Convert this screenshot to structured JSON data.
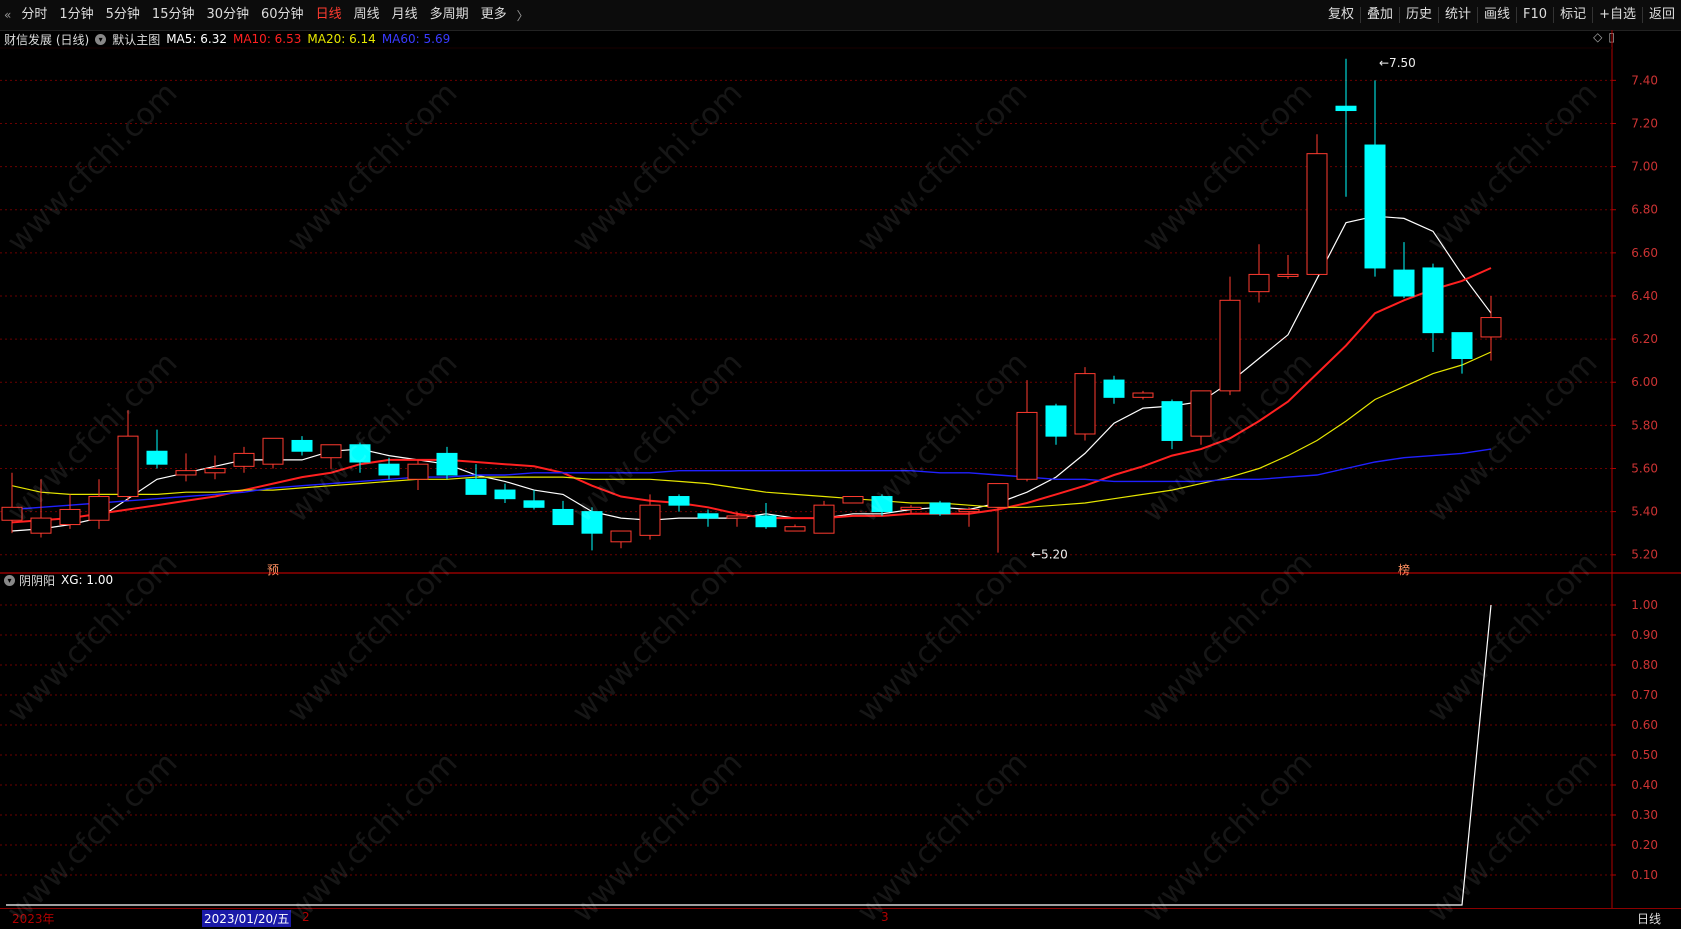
{
  "toolbar": {
    "left_items": [
      "分时",
      "1分钟",
      "5分钟",
      "15分钟",
      "30分钟",
      "60分钟",
      "日线",
      "周线",
      "月线",
      "多周期",
      "更多"
    ],
    "active": "日线",
    "right_items": [
      "复权",
      "叠加",
      "历史",
      "统计",
      "画线",
      "F10",
      "标记",
      "+自选",
      "返回"
    ]
  },
  "main_info": {
    "stock": "财信发展 (日线)",
    "chart_name": "默认主图",
    "ma5": "MA5: 6.32",
    "ma10": "MA10: 6.53",
    "ma20": "MA20: 6.14",
    "ma60": "MA60: 5.69"
  },
  "indicator_info": {
    "name": "阴阴阳",
    "value": "XG: 1.00"
  },
  "bottom": {
    "year": "2023年",
    "cursor_date": "2023/01/20/五",
    "month2": "2",
    "month3": "3",
    "period": "日线"
  },
  "watermark": "www.cfchi.com",
  "colors": {
    "up": "#ff3b30",
    "down": "#00ffff",
    "ma5": "#ffffff",
    "ma10": "#ff2020",
    "ma20": "#e6e600",
    "ma60": "#2020ff",
    "grid": "#6b0000",
    "axis": "#b00000"
  },
  "chart_data": [
    {
      "type": "candlestick",
      "title": "财信发展 (日线)",
      "ylim": [
        5.12,
        7.55
      ],
      "y_ticks": [
        5.2,
        5.4,
        5.6,
        5.8,
        6.0,
        6.2,
        6.4,
        6.6,
        6.8,
        7.0,
        7.2,
        7.4
      ],
      "annotations": [
        {
          "text": "7.50",
          "x": 47,
          "y": 7.5
        },
        {
          "text": "5.20",
          "x": 35,
          "y": 5.2
        },
        {
          "text": "预",
          "x": 9
        },
        {
          "text": "榜",
          "x": 48
        }
      ],
      "ohlc": [
        [
          5.36,
          5.58,
          5.3,
          5.42
        ],
        [
          5.3,
          5.55,
          5.28,
          5.37
        ],
        [
          5.34,
          5.48,
          5.32,
          5.41
        ],
        [
          5.36,
          5.55,
          5.32,
          5.47
        ],
        [
          5.47,
          5.87,
          5.45,
          5.75
        ],
        [
          5.68,
          5.78,
          5.6,
          5.62
        ],
        [
          5.57,
          5.67,
          5.54,
          5.59
        ],
        [
          5.58,
          5.66,
          5.55,
          5.6
        ],
        [
          5.61,
          5.7,
          5.58,
          5.67
        ],
        [
          5.62,
          5.74,
          5.6,
          5.74
        ],
        [
          5.73,
          5.75,
          5.66,
          5.68
        ],
        [
          5.65,
          5.71,
          5.6,
          5.71
        ],
        [
          5.71,
          5.72,
          5.58,
          5.63
        ],
        [
          5.62,
          5.65,
          5.55,
          5.57
        ],
        [
          5.55,
          5.64,
          5.5,
          5.62
        ],
        [
          5.67,
          5.7,
          5.55,
          5.57
        ],
        [
          5.55,
          5.62,
          5.48,
          5.48
        ],
        [
          5.5,
          5.53,
          5.44,
          5.46
        ],
        [
          5.45,
          5.5,
          5.41,
          5.42
        ],
        [
          5.41,
          5.45,
          5.34,
          5.34
        ],
        [
          5.4,
          5.42,
          5.22,
          5.3
        ],
        [
          5.26,
          5.31,
          5.23,
          5.31
        ],
        [
          5.29,
          5.48,
          5.27,
          5.43
        ],
        [
          5.47,
          5.48,
          5.4,
          5.43
        ],
        [
          5.39,
          5.41,
          5.33,
          5.37
        ],
        [
          5.37,
          5.4,
          5.33,
          5.38
        ],
        [
          5.38,
          5.44,
          5.32,
          5.33
        ],
        [
          5.31,
          5.34,
          5.31,
          5.33
        ],
        [
          5.3,
          5.45,
          5.3,
          5.43
        ],
        [
          5.44,
          5.47,
          5.44,
          5.47
        ],
        [
          5.47,
          5.48,
          5.38,
          5.4
        ],
        [
          5.41,
          5.43,
          5.39,
          5.42
        ],
        [
          5.44,
          5.45,
          5.38,
          5.39
        ],
        [
          5.4,
          5.42,
          5.33,
          5.41
        ],
        [
          5.42,
          5.53,
          5.21,
          5.53
        ],
        [
          5.55,
          6.01,
          5.54,
          5.86
        ],
        [
          5.89,
          5.9,
          5.71,
          5.75
        ],
        [
          5.76,
          6.07,
          5.73,
          6.04
        ],
        [
          6.01,
          6.03,
          5.9,
          5.93
        ],
        [
          5.93,
          5.96,
          5.92,
          5.95
        ],
        [
          5.91,
          5.92,
          5.69,
          5.73
        ],
        [
          5.75,
          5.96,
          5.71,
          5.96
        ],
        [
          5.96,
          6.49,
          5.94,
          6.38
        ],
        [
          6.42,
          6.64,
          6.37,
          6.5
        ],
        [
          6.5,
          6.59,
          6.48,
          6.5
        ],
        [
          6.5,
          7.15,
          6.5,
          7.06
        ],
        [
          7.28,
          7.5,
          6.86,
          7.26
        ],
        [
          7.1,
          7.4,
          6.49,
          6.53
        ],
        [
          6.52,
          6.65,
          6.39,
          6.4
        ],
        [
          6.53,
          6.55,
          6.14,
          6.23
        ],
        [
          6.23,
          6.23,
          6.04,
          6.11
        ],
        [
          6.21,
          6.4,
          6.1,
          6.3
        ]
      ],
      "series": [
        {
          "name": "MA5",
          "values": [
            5.31,
            5.32,
            5.34,
            5.37,
            5.46,
            5.55,
            5.58,
            5.61,
            5.64,
            5.64,
            5.64,
            5.68,
            5.69,
            5.66,
            5.64,
            5.62,
            5.57,
            5.54,
            5.5,
            5.48,
            5.4,
            5.37,
            5.36,
            5.37,
            5.37,
            5.37,
            5.39,
            5.37,
            5.37,
            5.39,
            5.39,
            5.41,
            5.42,
            5.41,
            5.44,
            5.49,
            5.56,
            5.67,
            5.81,
            5.88,
            5.89,
            5.91,
            6.0,
            6.11,
            6.22,
            6.48,
            6.74,
            6.77,
            6.76,
            6.7,
            6.5,
            6.32
          ]
        },
        {
          "name": "MA10",
          "values": [
            5.35,
            5.36,
            5.37,
            5.39,
            5.41,
            5.43,
            5.45,
            5.47,
            5.5,
            5.53,
            5.56,
            5.58,
            5.62,
            5.64,
            5.64,
            5.64,
            5.63,
            5.62,
            5.61,
            5.58,
            5.52,
            5.47,
            5.45,
            5.44,
            5.42,
            5.39,
            5.37,
            5.37,
            5.37,
            5.38,
            5.38,
            5.39,
            5.39,
            5.39,
            5.41,
            5.44,
            5.48,
            5.52,
            5.57,
            5.61,
            5.66,
            5.69,
            5.74,
            5.82,
            5.91,
            6.04,
            6.17,
            6.32,
            6.38,
            6.43,
            6.47,
            6.53
          ]
        },
        {
          "name": "MA20",
          "values": [
            5.52,
            5.49,
            5.48,
            5.48,
            5.48,
            5.48,
            5.49,
            5.49,
            5.5,
            5.5,
            5.51,
            5.52,
            5.53,
            5.54,
            5.55,
            5.55,
            5.56,
            5.56,
            5.56,
            5.56,
            5.55,
            5.55,
            5.55,
            5.54,
            5.53,
            5.51,
            5.49,
            5.48,
            5.47,
            5.46,
            5.45,
            5.44,
            5.44,
            5.43,
            5.42,
            5.42,
            5.43,
            5.44,
            5.46,
            5.48,
            5.5,
            5.53,
            5.56,
            5.6,
            5.66,
            5.73,
            5.82,
            5.92,
            5.98,
            6.04,
            6.08,
            6.14
          ]
        },
        {
          "name": "MA60",
          "values": [
            5.41,
            5.42,
            5.43,
            5.44,
            5.45,
            5.46,
            5.47,
            5.48,
            5.49,
            5.51,
            5.52,
            5.53,
            5.54,
            5.55,
            5.56,
            5.56,
            5.57,
            5.57,
            5.58,
            5.58,
            5.58,
            5.58,
            5.58,
            5.59,
            5.59,
            5.59,
            5.59,
            5.59,
            5.59,
            5.59,
            5.59,
            5.59,
            5.58,
            5.58,
            5.57,
            5.56,
            5.55,
            5.55,
            5.54,
            5.54,
            5.54,
            5.54,
            5.55,
            5.55,
            5.56,
            5.57,
            5.6,
            5.63,
            5.65,
            5.66,
            5.67,
            5.69
          ]
        }
      ]
    },
    {
      "type": "line",
      "title": "阴阴阳",
      "ylim": [
        0,
        1.05
      ],
      "y_ticks": [
        0.1,
        0.2,
        0.3,
        0.4,
        0.5,
        0.6,
        0.7,
        0.8,
        0.9,
        1.0
      ],
      "series": [
        {
          "name": "XG",
          "values": [
            0,
            0,
            0,
            0,
            0,
            0,
            0,
            0,
            0,
            0,
            0,
            0,
            0,
            0,
            0,
            0,
            0,
            0,
            0,
            0,
            0,
            0,
            0,
            0,
            0,
            0,
            0,
            0,
            0,
            0,
            0,
            0,
            0,
            0,
            0,
            0,
            0,
            0,
            0,
            0,
            0,
            0,
            0,
            0,
            0,
            0,
            0,
            0,
            0,
            0,
            0,
            1.0
          ]
        }
      ]
    }
  ]
}
